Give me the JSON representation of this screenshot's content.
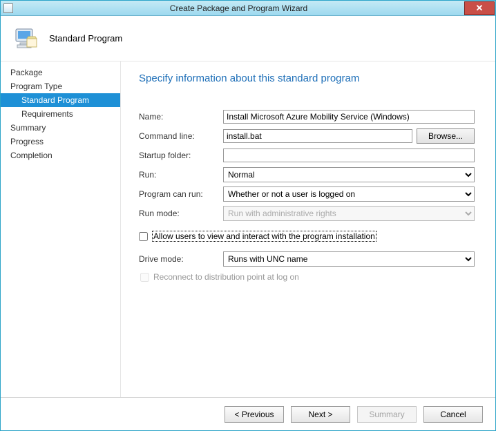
{
  "window": {
    "title": "Create Package and Program Wizard"
  },
  "header": {
    "title": "Standard Program"
  },
  "sidebar": {
    "items": [
      {
        "label": "Package",
        "sub": false,
        "selected": false
      },
      {
        "label": "Program Type",
        "sub": false,
        "selected": false
      },
      {
        "label": "Standard Program",
        "sub": true,
        "selected": true
      },
      {
        "label": "Requirements",
        "sub": true,
        "selected": false
      },
      {
        "label": "Summary",
        "sub": false,
        "selected": false
      },
      {
        "label": "Progress",
        "sub": false,
        "selected": false
      },
      {
        "label": "Completion",
        "sub": false,
        "selected": false
      }
    ]
  },
  "content": {
    "instruction": "Specify information about this standard program",
    "labels": {
      "name": "Name:",
      "command_line": "Command line:",
      "startup_folder": "Startup folder:",
      "run": "Run:",
      "program_can_run": "Program can run:",
      "run_mode": "Run mode:",
      "drive_mode": "Drive mode:"
    },
    "values": {
      "name": "Install Microsoft Azure Mobility Service (Windows)",
      "command_line": "install.bat",
      "startup_folder": "",
      "run": "Normal",
      "program_can_run": "Whether or not a user is logged on",
      "run_mode": "Run with administrative rights",
      "drive_mode": "Runs with UNC name"
    },
    "browse_label": "Browse...",
    "checkbox_allow": "Allow users to view and interact with the program installation",
    "checkbox_reconnect": "Reconnect to distribution point at log on"
  },
  "footer": {
    "previous": "< Previous",
    "next": "Next >",
    "summary": "Summary",
    "cancel": "Cancel"
  }
}
